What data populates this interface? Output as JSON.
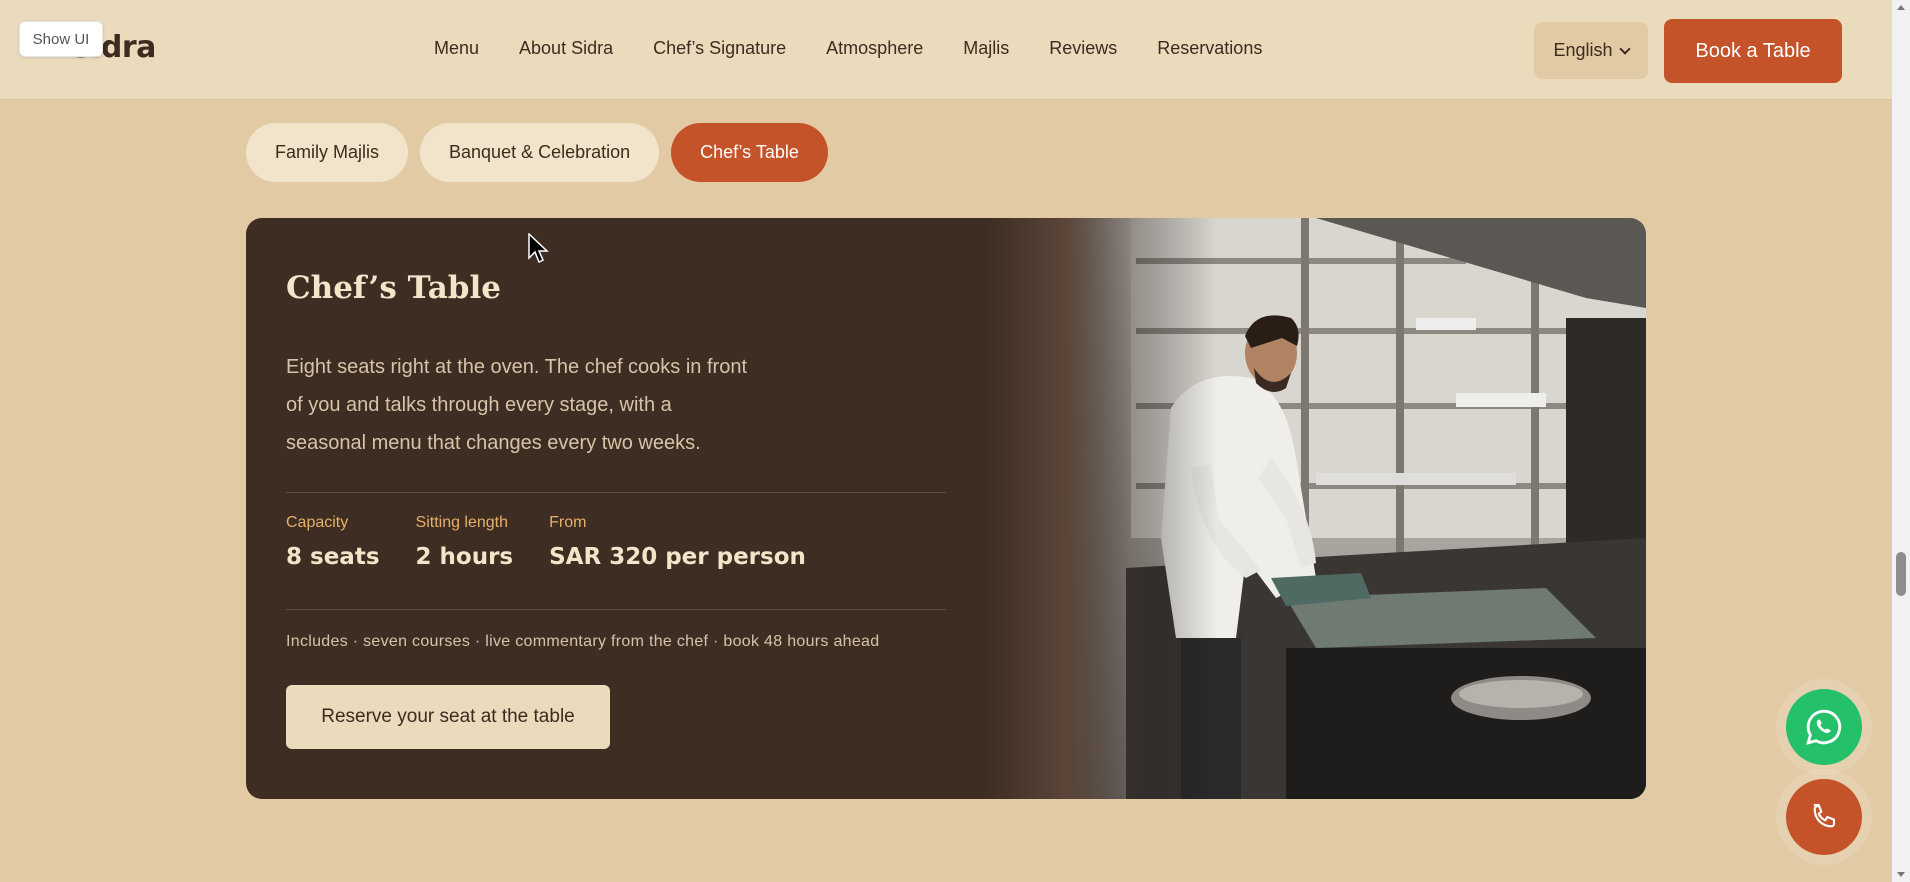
{
  "header": {
    "logo": "Sidra",
    "show_ui": "Show UI",
    "nav": [
      "Menu",
      "About Sidra",
      "Chef’s Signature",
      "Atmosphere",
      "Majlis",
      "Reviews",
      "Reservations"
    ],
    "language": "English",
    "book_button": "Book a Table"
  },
  "tabs": [
    {
      "label": "Family Majlis",
      "active": false
    },
    {
      "label": "Banquet & Celebration",
      "active": false
    },
    {
      "label": "Chef’s Table",
      "active": true
    }
  ],
  "card": {
    "title": "Chef’s Table",
    "description": "Eight seats right at the oven. The chef cooks in front of you and talks through every stage, with a seasonal menu that changes every two weeks.",
    "stats": [
      {
        "label": "Capacity",
        "value": "8 seats"
      },
      {
        "label": "Sitting length",
        "value": "2 hours"
      },
      {
        "label": "From",
        "value": "SAR 320 per person"
      }
    ],
    "includes": "Includes · seven courses · live commentary from the chef · book 48 hours ahead",
    "reserve_button": "Reserve your seat at the table"
  },
  "floating": {
    "whatsapp_icon": "whatsapp-icon",
    "phone_icon": "phone-icon"
  },
  "colors": {
    "accent": "#c4532a",
    "background": "#e2cba4",
    "card_dark": "#3e2d22",
    "whatsapp": "#25c06a"
  }
}
